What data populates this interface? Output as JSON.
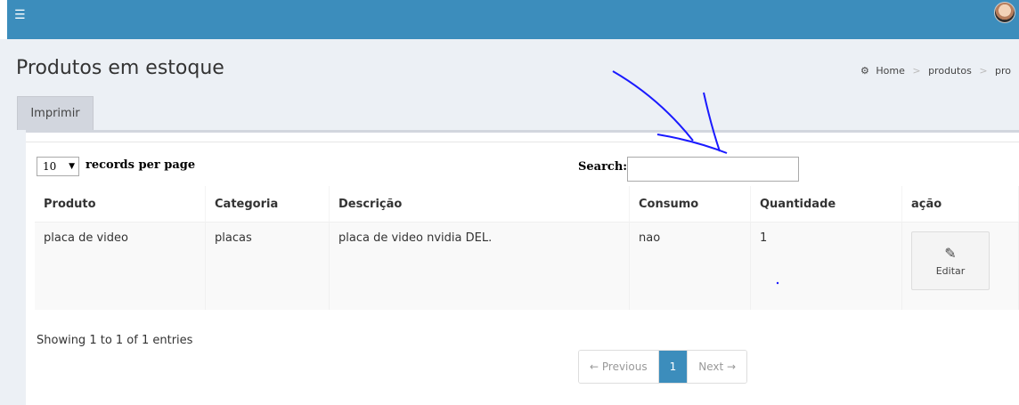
{
  "topbar": {
    "menu_icon": "hamburger-icon",
    "avatar_icon": "user-avatar"
  },
  "header": {
    "title": "Produtos em estoque",
    "breadcrumb": {
      "home": "Home",
      "item1": "produtos",
      "item2": "pro"
    }
  },
  "print_tab": {
    "label": "Imprimir"
  },
  "table_controls": {
    "length_value": "10",
    "length_label": "records per page",
    "search_label": "Search:",
    "search_value": ""
  },
  "table": {
    "columns": [
      "Produto",
      "Categoria",
      "Descrição",
      "Consumo",
      "Quantidade",
      "ação"
    ],
    "rows": [
      {
        "produto": "placa de video",
        "categoria": "placas",
        "descricao": "placa de video nvidia DEL.",
        "consumo": "nao",
        "quantidade": "1",
        "acao_label": "Editar"
      }
    ]
  },
  "footer": {
    "info": "Showing 1 to 1 of 1 entries",
    "pager": {
      "prev": "← Previous",
      "current": "1",
      "next": "Next →"
    }
  },
  "colors": {
    "topbar": "#3c8dbc",
    "active_page": "#3c8dbc",
    "annotation": "#1a1aff"
  }
}
